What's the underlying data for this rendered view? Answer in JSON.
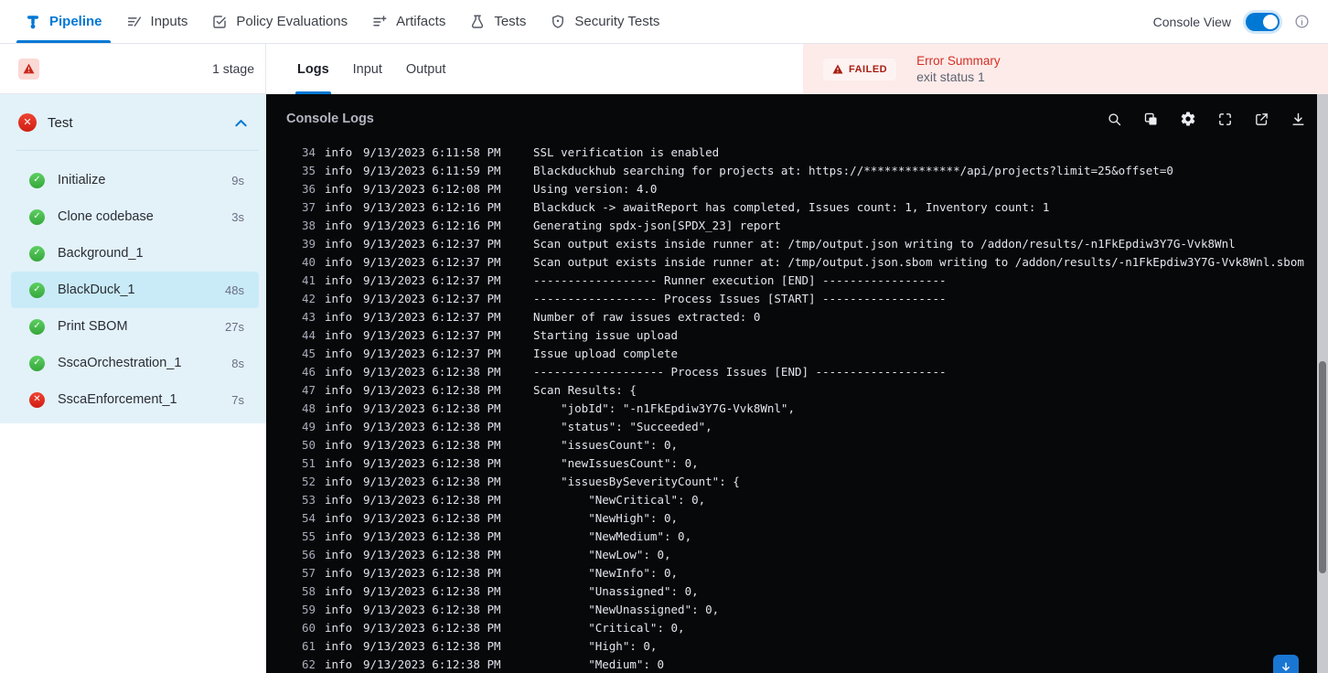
{
  "topnav": {
    "tabs": [
      "Pipeline",
      "Inputs",
      "Policy Evaluations",
      "Artifacts",
      "Tests",
      "Security Tests"
    ],
    "active_tab": "Pipeline",
    "console_view_label": "Console View",
    "console_view_on": true,
    "icons": [
      "pipeline-icon",
      "inputs-icon",
      "policy-evaluations-icon",
      "artifacts-icon",
      "tests-icon",
      "security-tests-icon",
      "info-icon"
    ]
  },
  "sidebar": {
    "stage_count": "1 stage",
    "stage_name": "Test",
    "stage_status": "failed",
    "steps": [
      {
        "name": "Initialize",
        "duration": "9s",
        "status": "success",
        "selected": false
      },
      {
        "name": "Clone codebase",
        "duration": "3s",
        "status": "success",
        "selected": false
      },
      {
        "name": "Background_1",
        "duration": "",
        "status": "success",
        "selected": false
      },
      {
        "name": "BlackDuck_1",
        "duration": "48s",
        "status": "success",
        "selected": true
      },
      {
        "name": "Print SBOM",
        "duration": "27s",
        "status": "success",
        "selected": false
      },
      {
        "name": "SscaOrchestration_1",
        "duration": "8s",
        "status": "success",
        "selected": false
      },
      {
        "name": "SscaEnforcement_1",
        "duration": "7s",
        "status": "failed",
        "selected": false
      }
    ]
  },
  "main": {
    "tabs": [
      "Logs",
      "Input",
      "Output"
    ],
    "active_tab": "Logs",
    "error": {
      "badge": "FAILED",
      "title": "Error Summary",
      "message": "exit status 1"
    },
    "console_title": "Console Logs",
    "console_icons": [
      "search-icon",
      "copy-icon",
      "settings-icon",
      "fullscreen-icon",
      "open-in-new-icon",
      "download-icon",
      "scroll-to-bottom-icon"
    ],
    "logs": [
      {
        "n": "34",
        "level": "info",
        "time": "9/13/2023 6:11:58 PM",
        "msg": "SSL verification is enabled"
      },
      {
        "n": "35",
        "level": "info",
        "time": "9/13/2023 6:11:59 PM",
        "msg": "Blackduckhub searching for projects at: https://**************/api/projects?limit=25&offset=0"
      },
      {
        "n": "36",
        "level": "info",
        "time": "9/13/2023 6:12:08 PM",
        "msg": "Using version: 4.0"
      },
      {
        "n": "37",
        "level": "info",
        "time": "9/13/2023 6:12:16 PM",
        "msg": "Blackduck -> awaitReport has completed, Issues count: 1, Inventory count: 1"
      },
      {
        "n": "38",
        "level": "info",
        "time": "9/13/2023 6:12:16 PM",
        "msg": "Generating spdx-json[SPDX_23] report"
      },
      {
        "n": "39",
        "level": "info",
        "time": "9/13/2023 6:12:37 PM",
        "msg": "Scan output exists inside runner at: /tmp/output.json writing to /addon/results/-n1FkEpdiw3Y7G-Vvk8Wnl"
      },
      {
        "n": "40",
        "level": "info",
        "time": "9/13/2023 6:12:37 PM",
        "msg": "Scan output exists inside runner at: /tmp/output.json.sbom writing to /addon/results/-n1FkEpdiw3Y7G-Vvk8Wnl.sbom"
      },
      {
        "n": "41",
        "level": "info",
        "time": "9/13/2023 6:12:37 PM",
        "msg": "------------------ Runner execution [END] ------------------"
      },
      {
        "n": "42",
        "level": "info",
        "time": "9/13/2023 6:12:37 PM",
        "msg": "------------------ Process Issues [START] ------------------"
      },
      {
        "n": "43",
        "level": "info",
        "time": "9/13/2023 6:12:37 PM",
        "msg": "Number of raw issues extracted: 0"
      },
      {
        "n": "44",
        "level": "info",
        "time": "9/13/2023 6:12:37 PM",
        "msg": "Starting issue upload"
      },
      {
        "n": "45",
        "level": "info",
        "time": "9/13/2023 6:12:37 PM",
        "msg": "Issue upload complete"
      },
      {
        "n": "46",
        "level": "info",
        "time": "9/13/2023 6:12:38 PM",
        "msg": "------------------- Process Issues [END] -------------------"
      },
      {
        "n": "47",
        "level": "info",
        "time": "9/13/2023 6:12:38 PM",
        "msg": "Scan Results: {"
      },
      {
        "n": "48",
        "level": "info",
        "time": "9/13/2023 6:12:38 PM",
        "msg": "    \"jobId\": \"-n1FkEpdiw3Y7G-Vvk8Wnl\","
      },
      {
        "n": "49",
        "level": "info",
        "time": "9/13/2023 6:12:38 PM",
        "msg": "    \"status\": \"Succeeded\","
      },
      {
        "n": "50",
        "level": "info",
        "time": "9/13/2023 6:12:38 PM",
        "msg": "    \"issuesCount\": 0,"
      },
      {
        "n": "51",
        "level": "info",
        "time": "9/13/2023 6:12:38 PM",
        "msg": "    \"newIssuesCount\": 0,"
      },
      {
        "n": "52",
        "level": "info",
        "time": "9/13/2023 6:12:38 PM",
        "msg": "    \"issuesBySeverityCount\": {"
      },
      {
        "n": "53",
        "level": "info",
        "time": "9/13/2023 6:12:38 PM",
        "msg": "        \"NewCritical\": 0,"
      },
      {
        "n": "54",
        "level": "info",
        "time": "9/13/2023 6:12:38 PM",
        "msg": "        \"NewHigh\": 0,"
      },
      {
        "n": "55",
        "level": "info",
        "time": "9/13/2023 6:12:38 PM",
        "msg": "        \"NewMedium\": 0,"
      },
      {
        "n": "56",
        "level": "info",
        "time": "9/13/2023 6:12:38 PM",
        "msg": "        \"NewLow\": 0,"
      },
      {
        "n": "57",
        "level": "info",
        "time": "9/13/2023 6:12:38 PM",
        "msg": "        \"NewInfo\": 0,"
      },
      {
        "n": "58",
        "level": "info",
        "time": "9/13/2023 6:12:38 PM",
        "msg": "        \"Unassigned\": 0,"
      },
      {
        "n": "59",
        "level": "info",
        "time": "9/13/2023 6:12:38 PM",
        "msg": "        \"NewUnassigned\": 0,"
      },
      {
        "n": "60",
        "level": "info",
        "time": "9/13/2023 6:12:38 PM",
        "msg": "        \"Critical\": 0,"
      },
      {
        "n": "61",
        "level": "info",
        "time": "9/13/2023 6:12:38 PM",
        "msg": "        \"High\": 0,"
      },
      {
        "n": "62",
        "level": "info",
        "time": "9/13/2023 6:12:38 PM",
        "msg": "        \"Medium\": 0"
      }
    ]
  },
  "colors": {
    "accent": "#0278d5",
    "success": "#42ab45",
    "danger": "#e0281c",
    "error_bar_bg": "#fcebe9",
    "sidebar_bg": "#e3f2f9",
    "selected_step_bg": "#c9ebf8",
    "console_bg": "#070809"
  }
}
